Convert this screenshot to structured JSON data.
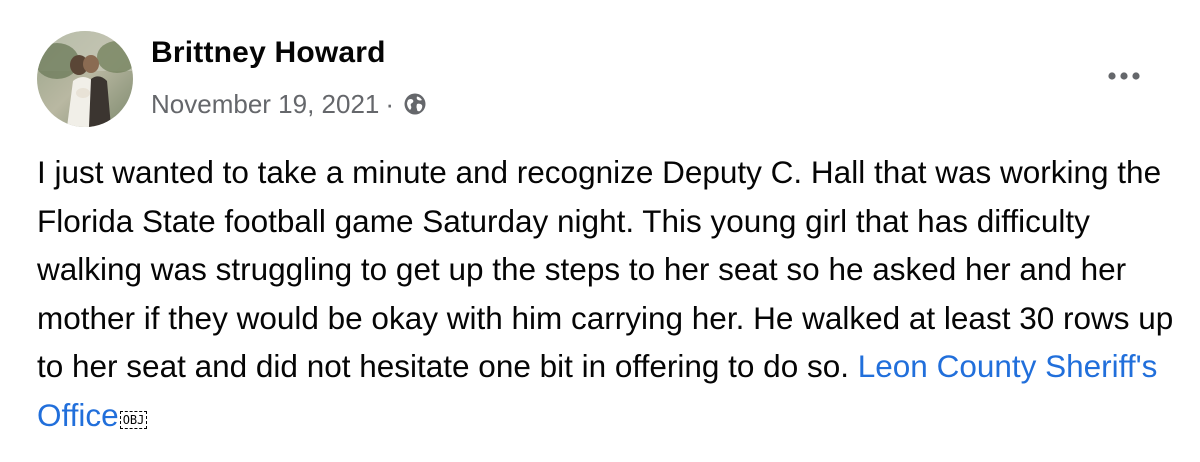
{
  "post": {
    "author": "Brittney Howard",
    "date": "November 19, 2021",
    "separator": "·",
    "audience_icon": "globe-icon",
    "more_icon": "more-options-icon",
    "body_text": "I just wanted to take a minute and recognize Deputy C. Hall that was working the Florida State football game Saturday night. This young girl that has difficulty walking was struggling to get up the steps to her seat so he asked her and her mother if they would be okay with him carrying her. He walked at least 30 rows up to her seat and did not hesitate one bit in offering to do so. ",
    "mention": "Leon County Sheriff's Office",
    "object_glyph": "OBJ"
  },
  "colors": {
    "text": "#050505",
    "secondary_text": "#65676b",
    "link": "#216fdb",
    "background": "#ffffff"
  }
}
